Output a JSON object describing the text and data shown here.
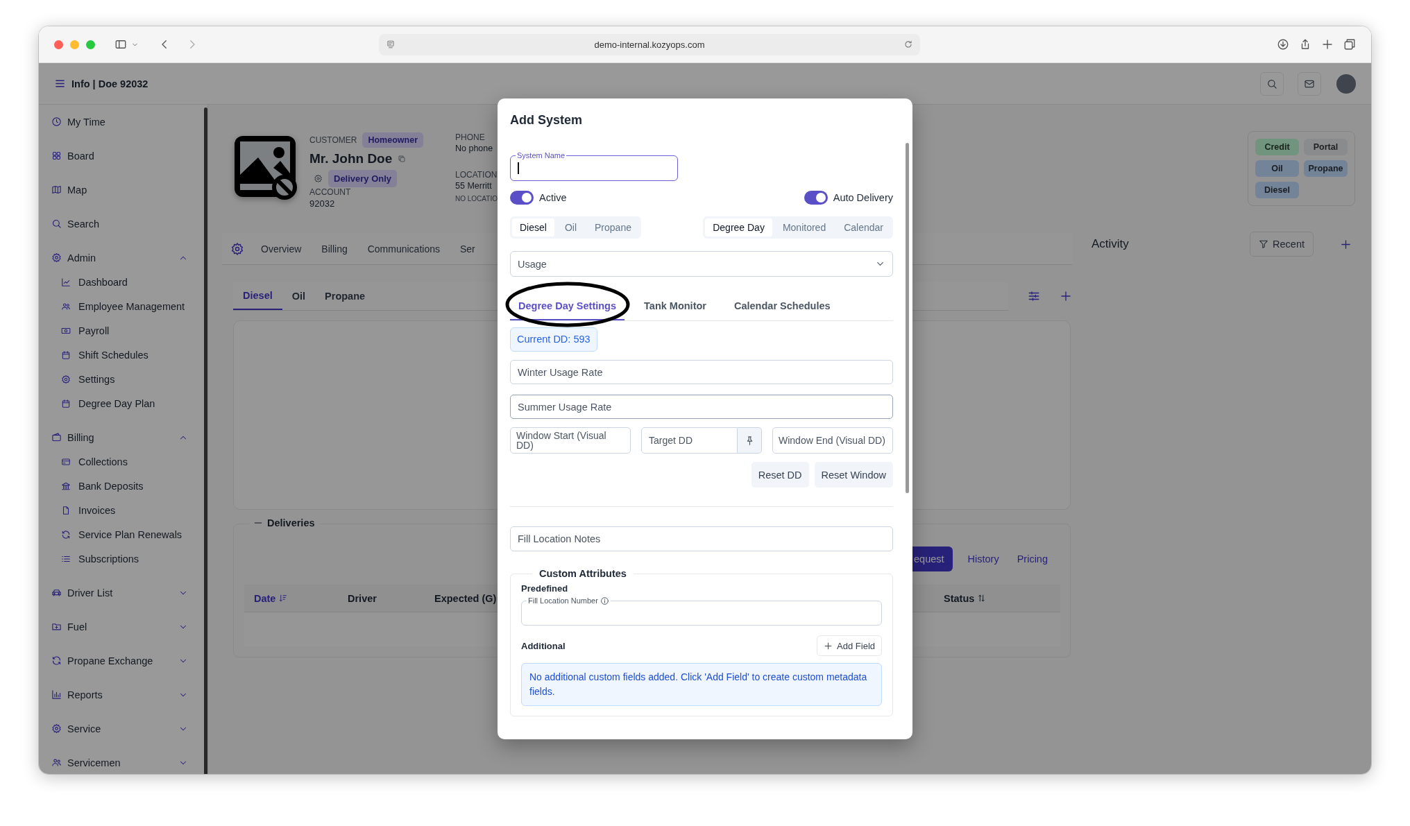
{
  "browser": {
    "url": "demo-internal.kozyops.com"
  },
  "header": {
    "title": "Info | Doe 92032"
  },
  "sidebar": {
    "items": [
      {
        "label": "My Time",
        "kind": "link"
      },
      {
        "label": "Board",
        "kind": "link"
      },
      {
        "label": "Map",
        "kind": "link"
      },
      {
        "label": "Search",
        "kind": "link"
      },
      {
        "label": "Admin",
        "kind": "group",
        "expanded": true,
        "children": [
          {
            "label": "Dashboard"
          },
          {
            "label": "Employee Management"
          },
          {
            "label": "Payroll"
          },
          {
            "label": "Shift Schedules"
          },
          {
            "label": "Settings"
          },
          {
            "label": "Degree Day Plan"
          }
        ]
      },
      {
        "label": "Billing",
        "kind": "group",
        "expanded": true,
        "children": [
          {
            "label": "Collections"
          },
          {
            "label": "Bank Deposits"
          },
          {
            "label": "Invoices"
          },
          {
            "label": "Service Plan Renewals"
          },
          {
            "label": "Subscriptions"
          }
        ]
      },
      {
        "label": "Driver List",
        "kind": "group",
        "expanded": false
      },
      {
        "label": "Fuel",
        "kind": "group",
        "expanded": false
      },
      {
        "label": "Propane Exchange",
        "kind": "group",
        "expanded": false
      },
      {
        "label": "Reports",
        "kind": "group",
        "expanded": false
      },
      {
        "label": "Service",
        "kind": "group",
        "expanded": false
      },
      {
        "label": "Servicemen",
        "kind": "group",
        "expanded": false
      }
    ]
  },
  "customer": {
    "label": "CUSTOMER",
    "type_badge": "Homeowner",
    "name": "Mr. John Doe",
    "service_badge": "Delivery Only",
    "account_label": "ACCOUNT",
    "account": "92032",
    "phone_label": "PHONE",
    "phone": "No phone",
    "location_label": "LOCATION",
    "location": "55 Merritt",
    "location_note": "NO LOCATIO"
  },
  "tabs": [
    {
      "label": "Overview",
      "selected": false
    },
    {
      "label": "Billing",
      "selected": false
    },
    {
      "label": "Communications",
      "selected": false
    },
    {
      "label": "Ser",
      "selected": false
    }
  ],
  "fuel_tabs": [
    {
      "label": "Diesel",
      "selected": true
    },
    {
      "label": "Oil",
      "selected": false
    },
    {
      "label": "Propane",
      "selected": false
    }
  ],
  "deliveries": {
    "title": "Deliveries",
    "actions": [
      {
        "label": "equest",
        "kind": "primary"
      },
      {
        "label": "History",
        "kind": "link"
      },
      {
        "label": "Pricing",
        "kind": "link"
      }
    ],
    "columns": [
      {
        "label": "Date",
        "sorted": true
      },
      {
        "label": "Driver"
      },
      {
        "label": "Expected (G)"
      },
      {
        "label": "Status",
        "sorted": false
      }
    ]
  },
  "tags": [
    {
      "label": "Credit",
      "color": "#70947d"
    },
    {
      "label": "Portal",
      "color": "#898b8d"
    },
    {
      "label": "Oil",
      "color": "#738398"
    },
    {
      "label": "Propane",
      "color": "#738398"
    },
    {
      "label": "Diesel",
      "color": "#738398"
    }
  ],
  "activity": {
    "title": "Activity",
    "filter": "Recent"
  },
  "modal": {
    "title": "Add System",
    "system_name": {
      "label": "System Name",
      "focused": true
    },
    "toggles": [
      {
        "label": "Active",
        "on": true
      },
      {
        "label": "Auto Delivery",
        "on": true
      }
    ],
    "fuel_types": [
      {
        "label": "Diesel",
        "selected": true
      },
      {
        "label": "Oil",
        "selected": false
      },
      {
        "label": "Propane",
        "selected": false
      }
    ],
    "modes": [
      {
        "label": "Degree Day",
        "selected": true
      },
      {
        "label": "Monitored",
        "selected": false
      },
      {
        "label": "Calendar",
        "selected": false
      }
    ],
    "usage_select": {
      "value": "Usage"
    },
    "tabs": [
      {
        "label": "Degree Day Settings",
        "selected": true,
        "circled": true
      },
      {
        "label": "Tank Monitor",
        "selected": false,
        "circled": false
      },
      {
        "label": "Calendar Schedules",
        "selected": false,
        "circled": false
      }
    ],
    "current_dd": "Current DD: 593",
    "winter_rate": {
      "placeholder": "Winter Usage Rate"
    },
    "summer_rate": {
      "placeholder": "Summer Usage Rate"
    },
    "window_start": {
      "placeholder": "Window Start (Visual DD)"
    },
    "target_dd": {
      "placeholder": "Target DD"
    },
    "window_end": {
      "placeholder": "Window End (Visual DD)"
    },
    "reset_buttons": [
      "Reset DD",
      "Reset Window"
    ],
    "fill_notes": {
      "placeholder": "Fill Location Notes"
    },
    "custom_attributes": {
      "title": "Custom Attributes",
      "predefined_label": "Predefined",
      "predefined_field": {
        "label": "Fill Location Number"
      },
      "additional_label": "Additional",
      "add_button": "Add Field",
      "empty_message": "No additional custom fields added. Click 'Add Field' to create custom metadata fields."
    }
  }
}
